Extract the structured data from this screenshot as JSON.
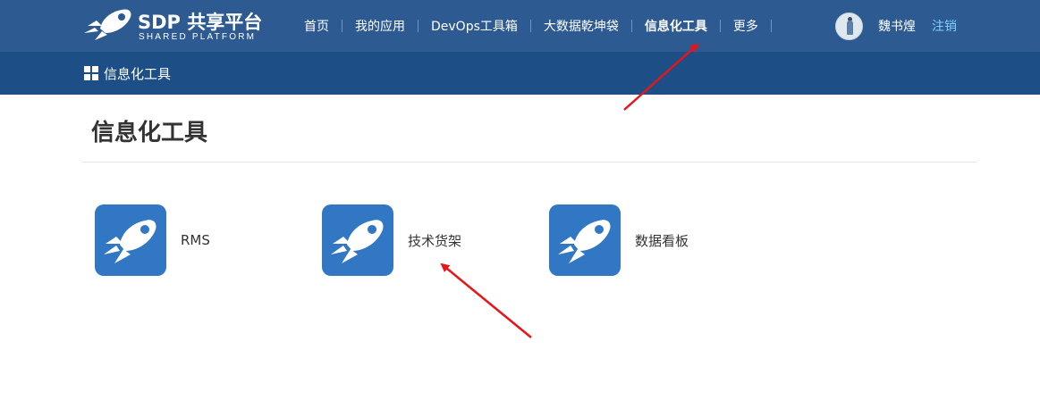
{
  "brand": {
    "title": "SDP 共享平台",
    "subtitle": "SHARED PLATFORM"
  },
  "nav": {
    "items": [
      {
        "label": "首页"
      },
      {
        "label": "我的应用"
      },
      {
        "label": "DevOps工具箱"
      },
      {
        "label": "大数据乾坤袋"
      },
      {
        "label": "信息化工具",
        "active": true
      },
      {
        "label": "更多"
      }
    ]
  },
  "user": {
    "name": "魏书煌",
    "logout_label": "注销"
  },
  "breadcrumb": {
    "label": "信息化工具"
  },
  "page": {
    "title": "信息化工具"
  },
  "tools": [
    {
      "label": "RMS",
      "icon": "rocket-icon"
    },
    {
      "label": "技术货架",
      "icon": "rocket-icon"
    },
    {
      "label": "数据看板",
      "icon": "rocket-icon"
    }
  ],
  "colors": {
    "topbar": "#2d5a91",
    "subbar": "#1d4f86",
    "tool_icon_bg": "#3177c4",
    "logout_link": "#7fd0ff",
    "annotation_arrow": "#e8141a"
  }
}
